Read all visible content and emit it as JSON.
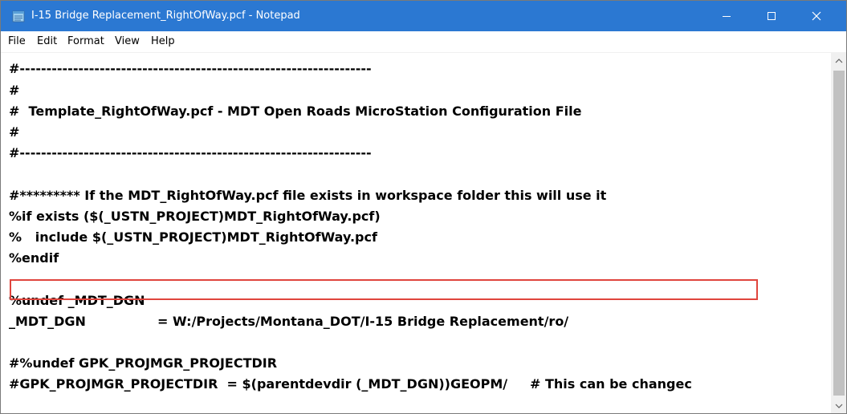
{
  "window": {
    "title": "I-15 Bridge Replacement_RightOfWay.pcf - Notepad",
    "icon": "notepad-icon",
    "title_bar_color": "#2b78d2"
  },
  "menu": {
    "items": [
      "File",
      "Edit",
      "Format",
      "View",
      "Help"
    ]
  },
  "editor": {
    "lines": [
      "#------------------------------------------------------------------",
      "#",
      "#  Template_RightOfWay.pcf - MDT Open Roads MicroStation Configuration File",
      "#",
      "#------------------------------------------------------------------",
      "",
      "#********* If the MDT_RightOfWay.pcf file exists in workspace folder this will use it",
      "%if exists ($(_USTN_PROJECT)MDT_RightOfWay.pcf)",
      "%   include $(_USTN_PROJECT)MDT_RightOfWay.pcf",
      "%endif",
      "",
      "%undef _MDT_DGN",
      "_MDT_DGN                = W:/Projects/Montana_DOT/I-15 Bridge Replacement/ro/",
      "",
      "#%undef GPK_PROJMGR_PROJECTDIR",
      "#GPK_PROJMGR_PROJECTDIR  = $(parentdevdir (_MDT_DGN))GEOPM/     # This can be changec"
    ],
    "highlighted_line_index": 12,
    "highlight_color": "#e0453d"
  },
  "scrollbar": {
    "up_icon": "scroll-up-arrow-icon",
    "down_icon": "scroll-down-arrow-icon"
  }
}
